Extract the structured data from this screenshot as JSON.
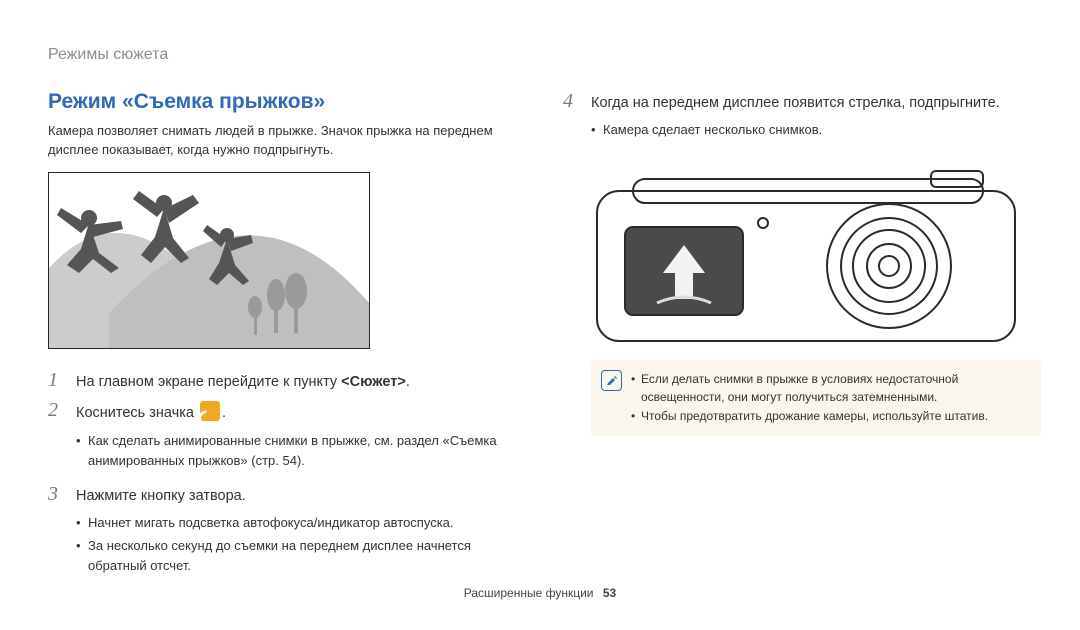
{
  "header": {
    "breadcrumb": "Режимы сюжета"
  },
  "section": {
    "title": "Режим «Съемка прыжков»",
    "intro": "Камера позволяет снимать людей в прыжке. Значок прыжка на переднем дисплее показывает, когда нужно подпрыгнуть."
  },
  "steps": {
    "s1": {
      "num": "1",
      "text_pre": "На главном экране перейдите к пункту ",
      "text_bold": "<Сюжет>",
      "text_post": "."
    },
    "s2": {
      "num": "2",
      "text_pre": "Коснитесь значка ",
      "text_post": "."
    },
    "s2_sub": {
      "a": "Как сделать анимированные снимки в прыжке, см. раздел «Съемка анимированных прыжков» (стр. 54)."
    },
    "s3": {
      "num": "3",
      "text": "Нажмите кнопку затвора."
    },
    "s3_sub": {
      "a": "Начнет мигать подсветка автофокуса/индикатор автоспуска.",
      "b": "За несколько секунд до съемки на переднем дисплее начнется обратный отсчет."
    },
    "s4": {
      "num": "4",
      "text": "Когда на переднем дисплее появится стрелка, подпрыгните."
    },
    "s4_sub": {
      "a": "Камера сделает несколько снимков."
    }
  },
  "note": {
    "icon": "✎",
    "a": "Если делать снимки в прыжке в условиях недостаточной освещенности, они могут получиться затемненными.",
    "b": "Чтобы предотвратить дрожание камеры, используйте штатив."
  },
  "footer": {
    "section": "Расширенные функции",
    "page": "53"
  }
}
